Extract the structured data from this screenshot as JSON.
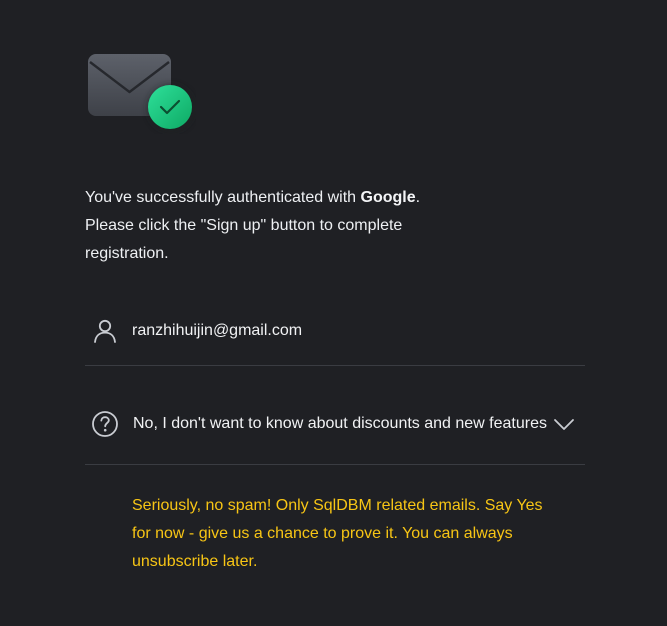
{
  "auth_message": {
    "line1_prefix": "You've successfully authenticated with ",
    "provider": "Google",
    "line1_suffix": ".",
    "line2": "Please click the \"Sign up\" button to complete registration."
  },
  "email_field": {
    "icon": "user-icon",
    "value": "ranzhihuijin@gmail.com"
  },
  "subscription_select": {
    "icon": "question-circle-icon",
    "value": "No, I don't want to know about discounts and new features",
    "dropdown_icon": "chevron-down-icon"
  },
  "spam_note": "Seriously, no spam! Only SqlDBM related emails. Say Yes for now - give us a chance to prove it. You can always unsubscribe later.",
  "colors": {
    "background": "#1f2024",
    "text": "#eef0f3",
    "accent_green": "#19c27a",
    "warning_yellow": "#f7c515",
    "divider": "#3a3c42"
  }
}
